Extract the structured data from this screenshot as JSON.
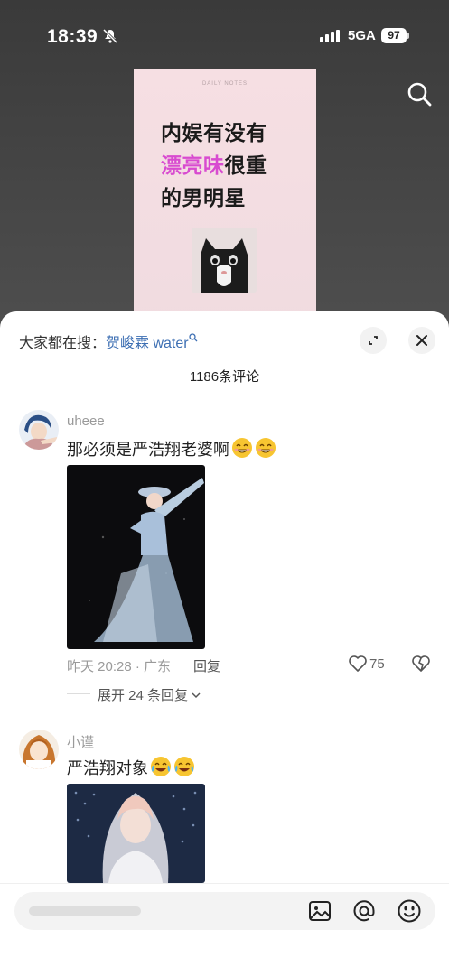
{
  "status_bar": {
    "time": "18:39",
    "network": "5GA",
    "battery": "97"
  },
  "post_card": {
    "subtitle": "DAILY NOTES",
    "line1": "内娱有没有",
    "line2_highlight": "漂亮味",
    "line2_rest": "很重",
    "line3": "的男明星"
  },
  "sheet": {
    "trending_prefix": "大家都在搜：",
    "trending_term": "贺峻霖 water",
    "comment_count": "1186条评论"
  },
  "comments": [
    {
      "username": "uheee",
      "text": "那必须是严浩翔老婆啊",
      "meta": "昨天 20:28 · 广东",
      "reply_label": "回复",
      "likes": "75",
      "expand_replies": "展开 24 条回复"
    },
    {
      "username": "小谨",
      "text": "严浩翔对象"
    }
  ],
  "composer": {
    "placeholder": ""
  },
  "icons": {
    "mute": "bell-slash-icon",
    "search": "search-icon",
    "expand": "expand-icon",
    "close": "close-icon",
    "like": "heart-icon",
    "dislike": "broken-heart-icon",
    "image": "image-icon",
    "mention": "at-icon",
    "emoji": "emoji-icon"
  },
  "colors": {
    "highlight": "#d84bd0",
    "link": "#3d6fb3",
    "muted": "#9a9a9a"
  }
}
